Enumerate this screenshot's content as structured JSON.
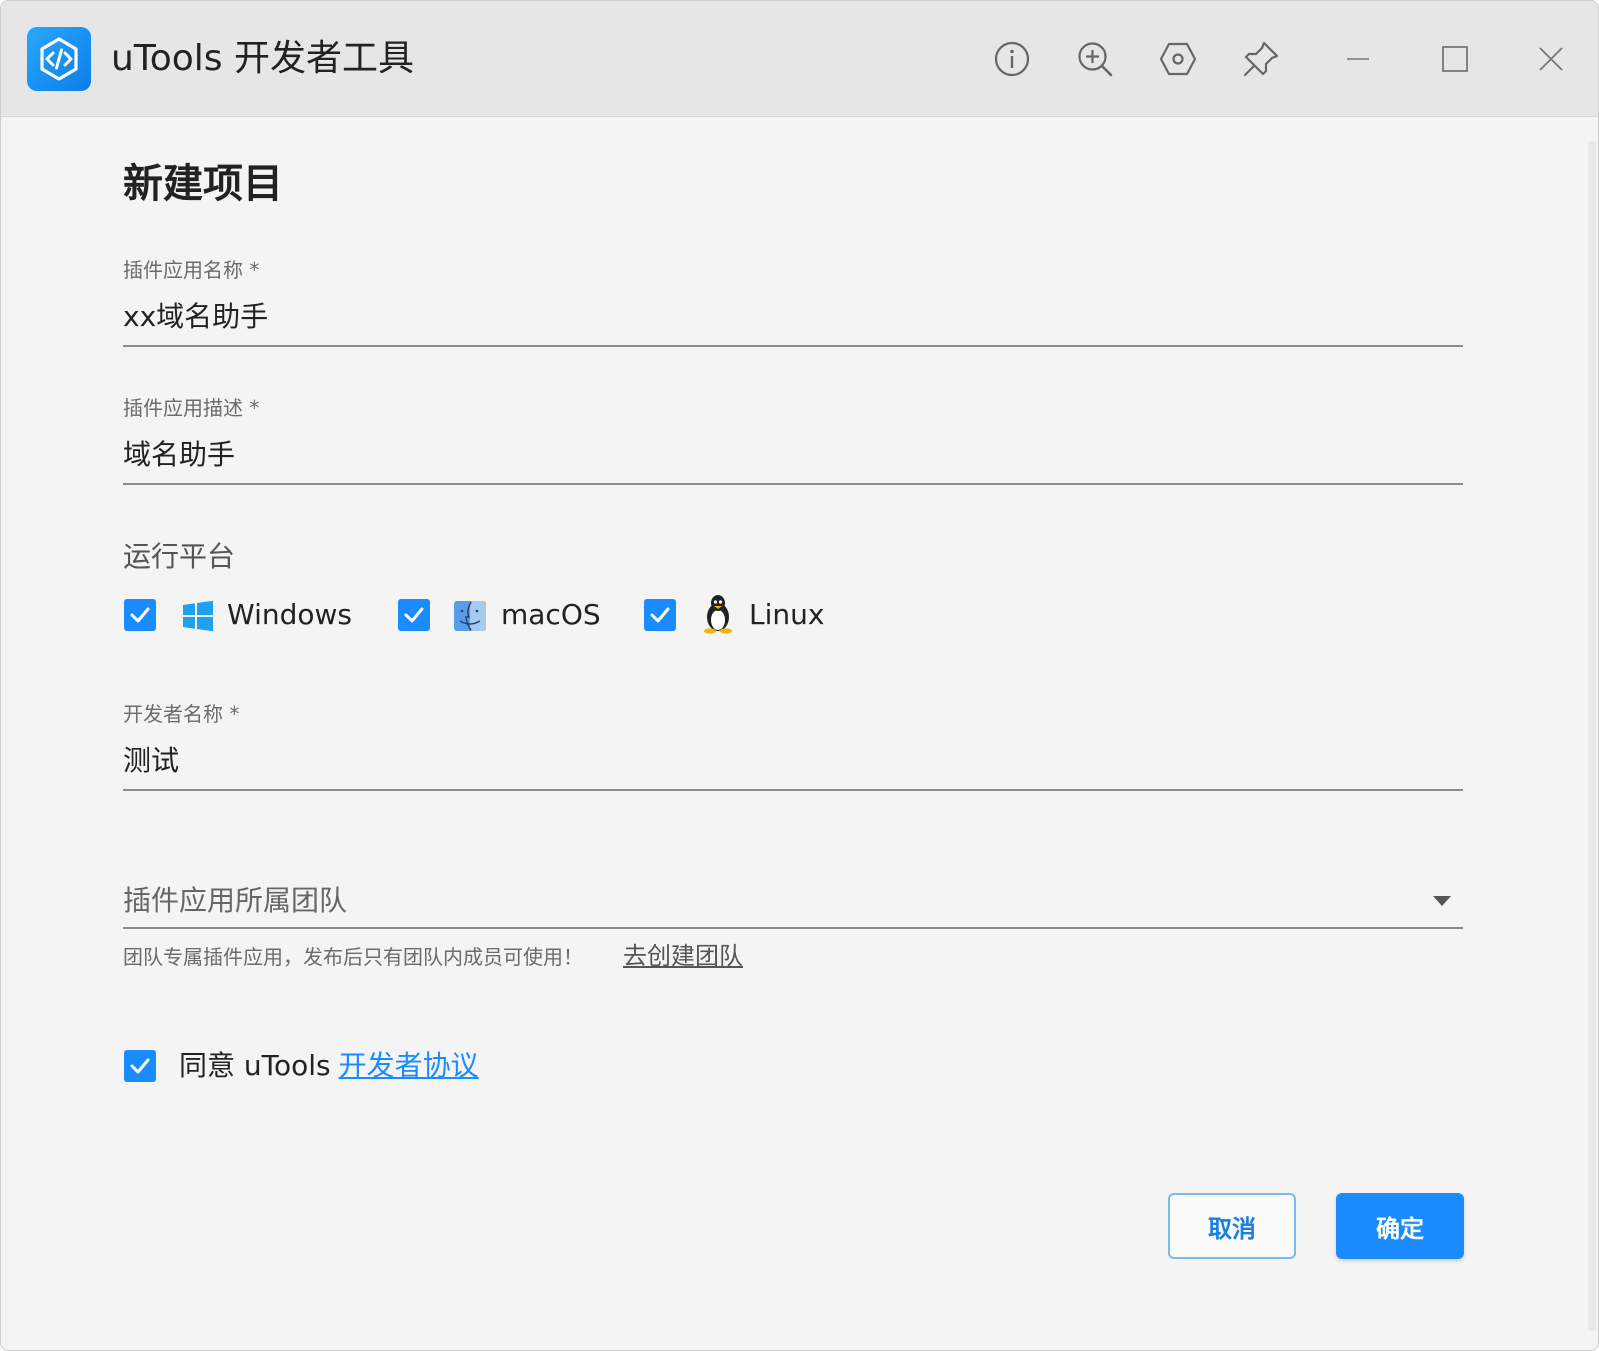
{
  "window": {
    "title": "uTools 开发者工具"
  },
  "page": {
    "title": "新建项目"
  },
  "form": {
    "name": {
      "label": "插件应用名称 *",
      "value": "xx域名助手"
    },
    "description": {
      "label": "插件应用描述 *",
      "value": "域名助手"
    },
    "platforms": {
      "label": "运行平台",
      "items": [
        {
          "label": "Windows",
          "checked": true,
          "icon": "windows-icon"
        },
        {
          "label": "macOS",
          "checked": true,
          "icon": "macos-icon"
        },
        {
          "label": "Linux",
          "checked": true,
          "icon": "linux-icon"
        }
      ]
    },
    "developer": {
      "label": "开发者名称 *",
      "value": "测试"
    },
    "team": {
      "placeholder": "插件应用所属团队",
      "hint": "团队专属插件应用，发布后只有团队内成员可使用！",
      "create_link": "去创建团队"
    },
    "agreement": {
      "checked": true,
      "text": "同意 uTools",
      "link": "开发者协议"
    }
  },
  "buttons": {
    "cancel": "取消",
    "confirm": "确定"
  },
  "colors": {
    "accent": "#1a8cff",
    "titlebar": "#e6e6e6",
    "background": "#f4f4f4"
  }
}
